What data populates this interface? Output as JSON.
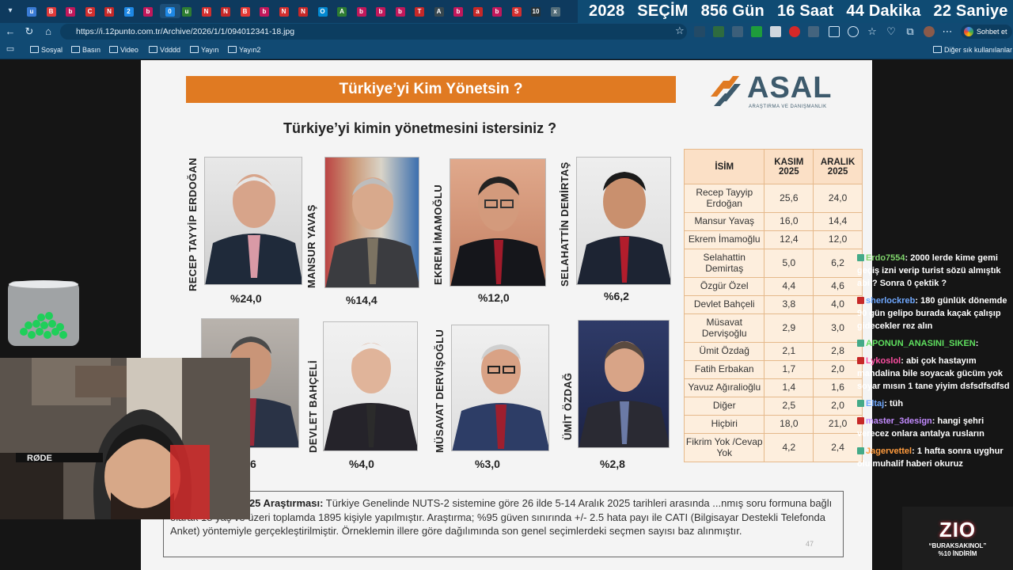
{
  "browser": {
    "tabs": [
      "u",
      "B",
      "b",
      "C",
      "N",
      "2",
      "b",
      "0",
      "u",
      "N",
      "N",
      "B",
      "b",
      "N",
      "N",
      "O",
      "A",
      "b",
      "b",
      "b",
      "T",
      "A",
      "b",
      "a",
      "b",
      "S",
      "10",
      "x"
    ],
    "url": "https://i.12punto.com.tr/Archive/2026/1/1/094012341-18.jpg",
    "chat_button": "Sohbet et",
    "bookmarks": [
      "Sosyal",
      "Basın",
      "Video",
      "Vdddd",
      "Yayın",
      "Yayın2"
    ],
    "other_bookmarks": "Diğer sık kullanılanlar"
  },
  "countdown": {
    "items": [
      "2028",
      "SEÇİM",
      "856 Gün",
      "16 Saat",
      "44 Dakika",
      "22 Saniye"
    ]
  },
  "slide": {
    "banner": "Türkiye’yi Kim Yönetsin ?",
    "brand": {
      "name": "ASAL",
      "subtitle": "ARAŞTIRMA VE DANIŞMANLIK"
    },
    "question": "Türkiye’yi kimin yönetmesini istersiniz ?",
    "candidates": [
      {
        "name": "RECEP TAYYİP ERDOĞAN",
        "pct": "%24,0"
      },
      {
        "name": "MANSUR YAVAŞ",
        "pct": "%14,4"
      },
      {
        "name": "EKREM İMAMOĞLU",
        "pct": "%12,0"
      },
      {
        "name": "SELAHATTİN DEMİRTAŞ",
        "pct": "%6,2"
      },
      {
        "name": "",
        "pct": "6"
      },
      {
        "name": "DEVLET BAHÇELİ",
        "pct": "%4,0"
      },
      {
        "name": "MÜSAVAT DERVİŞOĞLU",
        "pct": "%3,0"
      },
      {
        "name": "ÜMİT ÖZDAĞ",
        "pct": "%2,8"
      }
    ],
    "table": {
      "headers": [
        "İSİM",
        "KASIM 2025",
        "ARALIK 2025"
      ],
      "rows": [
        [
          "Recep Tayyip Erdoğan",
          "25,6",
          "24,0"
        ],
        [
          "Mansur Yavaş",
          "16,0",
          "14,4"
        ],
        [
          "Ekrem İmamoğlu",
          "12,4",
          "12,0"
        ],
        [
          "Selahattin Demirtaş",
          "5,0",
          "6,2"
        ],
        [
          "Özgür Özel",
          "4,4",
          "4,6"
        ],
        [
          "Devlet Bahçeli",
          "3,8",
          "4,0"
        ],
        [
          "Müsavat Dervişoğlu",
          "2,9",
          "3,0"
        ],
        [
          "Ümit Özdağ",
          "2,1",
          "2,8"
        ],
        [
          "Fatih Erbakan",
          "1,7",
          "2,0"
        ],
        [
          "Yavuz Ağıralioğlu",
          "1,4",
          "1,6"
        ],
        [
          "Diğer",
          "2,5",
          "2,0"
        ],
        [
          "Hiçbiri",
          "18,0",
          "21,0"
        ],
        [
          "Fikrim Yok /Cevap Yok",
          "4,2",
          "2,4"
        ]
      ]
    },
    "note_title": "ündem Aralık 2025 Araştırması:",
    "note_body": "Türkiye Genelinde NUTS-2 sistemine göre 26 ilde 5-14 Aralık 2025 tarihleri arasında ...nmış soru formuna bağlı olarak 18 yaş ve üzeri toplamda 1895 kişiyle yapılmıştır. Araştırma; %95 güven sınırında +/- 2.5 hata payı ile CATI (Bilgisayar Destekli Telefonda Anket) yöntemiyle gerçekleştirilmiştir. Örneklemin illere göre dağılımında son genel seçimlerdeki seçmen sayısı baz alınmıştır.",
    "page_number": "47"
  },
  "chat": {
    "messages": [
      {
        "user": "Erdo7554",
        "color": "#7fd46b",
        "text": "2000 lerde kime gemi geçiş izni verip turist sözü almıştık abi ? Sonra 0 çektik ?"
      },
      {
        "user": "sherlockreb",
        "color": "#6fa8ff",
        "text": "180 günlük dönemde 90 gün gelipo burada kaçak çalışıp gidecekler rez alın"
      },
      {
        "user": "APONUN_ANASINI_SIKEN",
        "color": "#5fe05f",
        "text": ""
      },
      {
        "user": "Lykoslol",
        "color": "#ff4fa3",
        "text": "abi çok hastayım mandalina bile soyacak gücüm yok soyar mısın 1 tane yiyim dsfsdfsdfsd"
      },
      {
        "user": "Eltaj",
        "color": "#6fa8ff",
        "text": "tüh"
      },
      {
        "user": "master_3design",
        "color": "#c38bff",
        "text": "hangi şehri verecez onlara antalya rusların"
      },
      {
        "user": "Jagervettel",
        "color": "#ff9b3d",
        "text": "1 hafta sonra uyghur olu muhalif haberi okuruz"
      }
    ]
  },
  "promo": {
    "brand": "ZIO",
    "line1": "“BURAKSAKINOL”",
    "line2": "%10 İNDİRİM"
  },
  "webcam": {
    "mic_label": "RØDE"
  }
}
